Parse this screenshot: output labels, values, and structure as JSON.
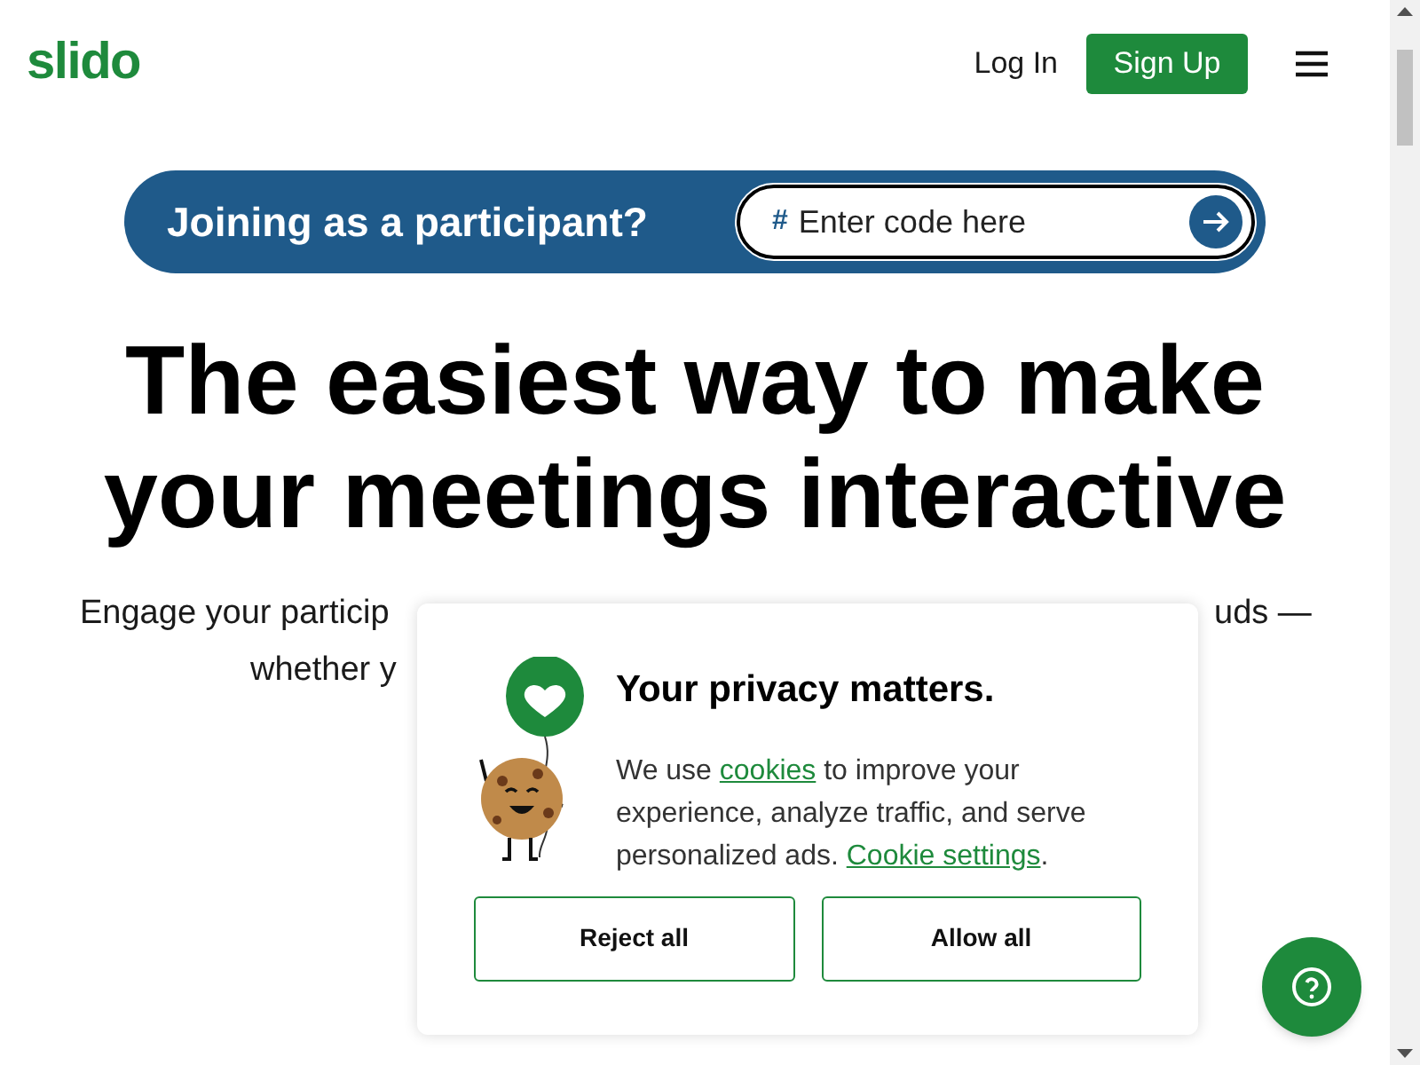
{
  "header": {
    "logo": "slido",
    "login": "Log In",
    "signup": "Sign Up"
  },
  "join": {
    "prompt": "Joining as a participant?",
    "hash": "#",
    "placeholder": "Enter code here"
  },
  "headline": [
    "The easiest way to make",
    "your meetings interactive"
  ],
  "subtitle_fragments": {
    "line_1_left": "Engage your particip",
    "line_1_right": "uds —",
    "line_2_left": "whether y"
  },
  "cookie_dialog": {
    "title": "Your privacy matters.",
    "text_before": "We use ",
    "link_1": "cookies",
    "text_middle": " to improve your experience, analyze traffic, and serve personalized ads. ",
    "link_2": "Cookie settings",
    "text_after": ".",
    "buttons": [
      "Reject all",
      "Allow all"
    ]
  }
}
